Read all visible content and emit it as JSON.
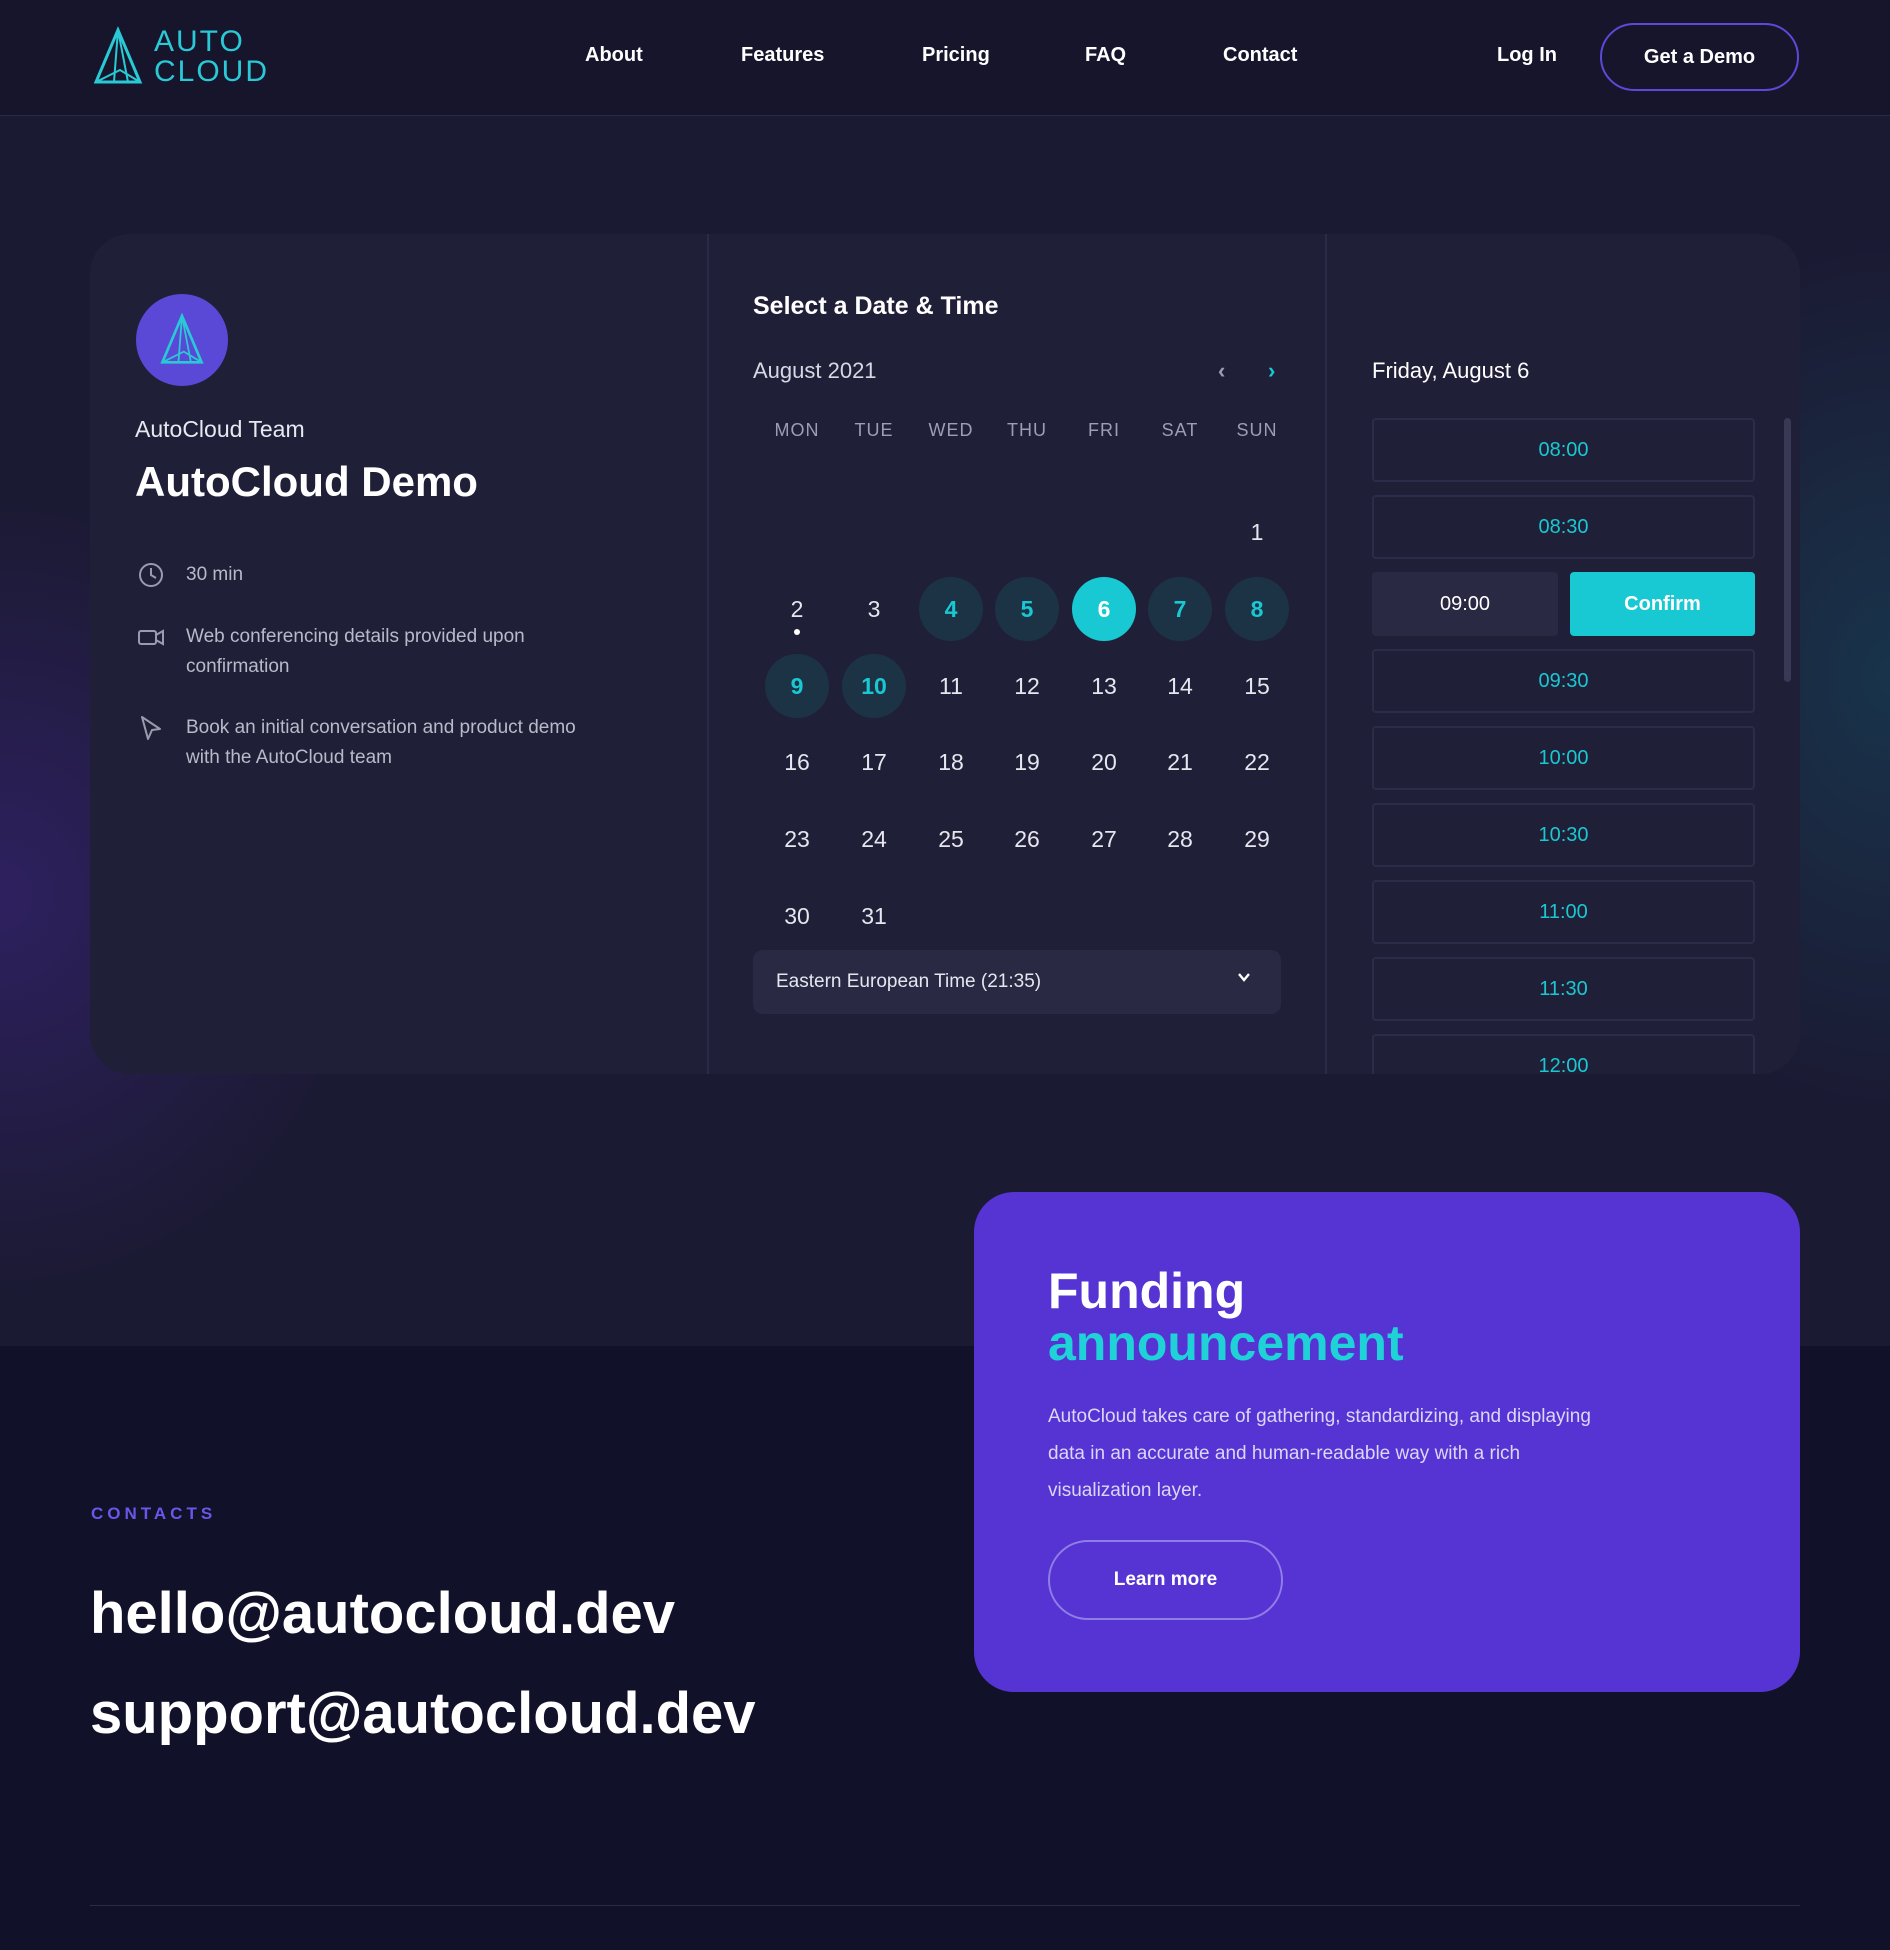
{
  "brand": {
    "logo_line1": "AUTO",
    "logo_line2": "CLOUD",
    "accent": "#19c8d2",
    "purple": "#5634d4"
  },
  "nav": {
    "links": [
      "About",
      "Features",
      "Pricing",
      "FAQ",
      "Contact"
    ],
    "login": "Log In",
    "cta": "Get a Demo"
  },
  "booking": {
    "team": "AutoCloud Team",
    "title": "AutoCloud Demo",
    "details": [
      {
        "icon": "clock-icon",
        "text": "30 min"
      },
      {
        "icon": "video-camera-icon",
        "text": "Web conferencing details provided upon confirmation"
      },
      {
        "icon": "cursor-icon",
        "text": "Book an initial conversation and product demo with the AutoCloud team"
      }
    ],
    "calendar": {
      "heading": "Select a Date & Time",
      "month": "August 2021",
      "prev_icon": "‹",
      "next_icon": "›",
      "weekdays": [
        "MON",
        "TUE",
        "WED",
        "THU",
        "FRI",
        "SAT",
        "SUN"
      ],
      "first_weekday_index": 6,
      "days_in_month": 31,
      "today": 2,
      "available": [
        4,
        5,
        7,
        8,
        9,
        10
      ],
      "selected": 6,
      "timezone": "Eastern European Time (21:35)"
    },
    "times": {
      "date_heading": "Friday, August 6",
      "slots": [
        "08:00",
        "08:30",
        "09:00",
        "09:30",
        "10:00",
        "10:30",
        "11:00",
        "11:30",
        "12:00"
      ],
      "selected_slot": "09:00",
      "confirm_label": "Confirm"
    }
  },
  "funding": {
    "title_line1": "Funding",
    "title_line2": "announcement",
    "text": "AutoCloud takes care of gathering, standardizing, and displaying data in an accurate and human-readable way with a rich visualization layer.",
    "button": "Learn more"
  },
  "contacts": {
    "label": "CONTACTS",
    "emails": [
      "hello@autocloud.dev",
      "support@autocloud.dev"
    ]
  }
}
